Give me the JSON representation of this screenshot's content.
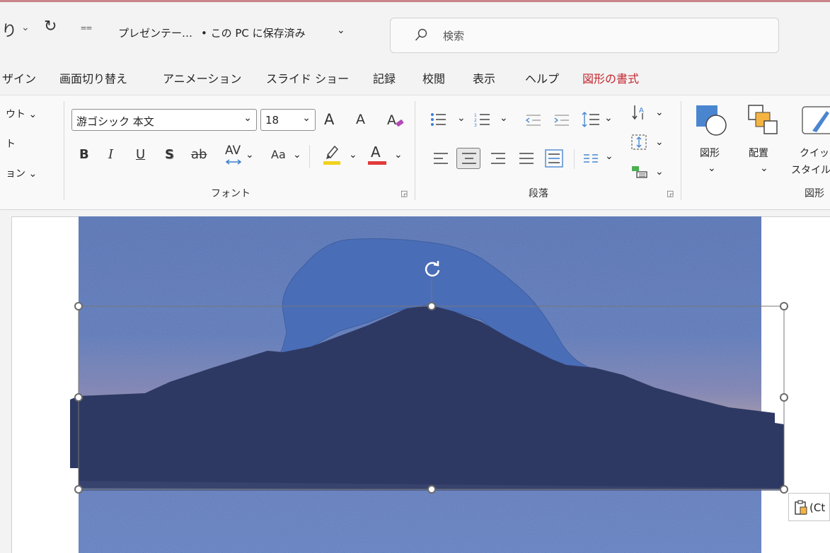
{
  "titlebar": {
    "undo_glyph": "り",
    "undo_caret": "⌄",
    "redo_glyph": "↻",
    "customize_qat": "⩵",
    "doc_title": "プレゼンテー…",
    "save_status": "• この PC に保存済み",
    "save_status_caret": "⌄",
    "search_placeholder": "検索"
  },
  "tabs": [
    {
      "label": "ザイン"
    },
    {
      "label": "画面切り替え"
    },
    {
      "label": "アニメーション"
    },
    {
      "label": "スライド ショー"
    },
    {
      "label": "記録"
    },
    {
      "label": "校閲"
    },
    {
      "label": "表示"
    },
    {
      "label": "ヘルプ"
    },
    {
      "label": "図形の書式",
      "active": true
    }
  ],
  "slides_group": {
    "layout": "ウト ⌄",
    "reset": "ト",
    "section": "ョン ⌄"
  },
  "font_group": {
    "font_name": "游ゴシック 本文",
    "font_size": "18",
    "grow_font": "A",
    "shrink_font": "A",
    "bold": "B",
    "italic": "I",
    "underline": "U",
    "shadow": "S",
    "strike": "ab",
    "char_spacing": "AV",
    "change_case": "Aa",
    "font_color": "A",
    "label": "フォント"
  },
  "paragraph_group": {
    "label": "段落"
  },
  "drawing_group": {
    "shapes_label": "図形",
    "arrange_label": "配置",
    "quick_styles_label_1": "クイッ",
    "quick_styles_label_2": "スタイル",
    "group_label_partial": "図形"
  },
  "paste_options": {
    "label": "(Ct"
  },
  "colors": {
    "accent_tab": "#c4262e",
    "sky": "#4e6fb3",
    "mountain": "#2e3963",
    "cloud": "#4a6db8",
    "highlight_yellow": "#f2d21b",
    "font_red": "#e23b3b"
  }
}
